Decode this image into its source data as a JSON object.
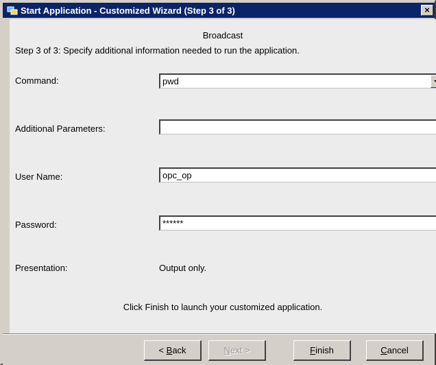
{
  "window": {
    "title": "Start Application - Customized Wizard (Step 3 of 3)",
    "close_glyph": "×"
  },
  "wizard": {
    "heading": "Broadcast",
    "step_text": "Step 3 of 3: Specify additional information needed to run the application.",
    "finish_note": "Click Finish to launch your customized application."
  },
  "form": {
    "command": {
      "label": "Command:",
      "value": "pwd"
    },
    "additional_parameters": {
      "label": "Additional Parameters:",
      "value": ""
    },
    "user_name": {
      "label": "User Name:",
      "value": "opc_op"
    },
    "password": {
      "label": "Password:",
      "value": "******"
    },
    "presentation": {
      "label": "Presentation:",
      "value": "Output only."
    }
  },
  "buttons": {
    "back": {
      "prefix": "< ",
      "mnemonic": "B",
      "rest": "ack",
      "enabled": true
    },
    "next": {
      "mnemonic": "N",
      "rest": "ext >",
      "enabled": false
    },
    "finish": {
      "mnemonic": "F",
      "rest": "inish",
      "enabled": true
    },
    "cancel": {
      "mnemonic": "C",
      "rest": "ancel",
      "enabled": true
    }
  },
  "colors": {
    "titlebar": "#0a246a",
    "dialog_face": "#d4d0c8",
    "content_bg": "#ececec"
  },
  "icons": [
    "app-icon",
    "close-icon",
    "dropdown-arrow-icon"
  ]
}
